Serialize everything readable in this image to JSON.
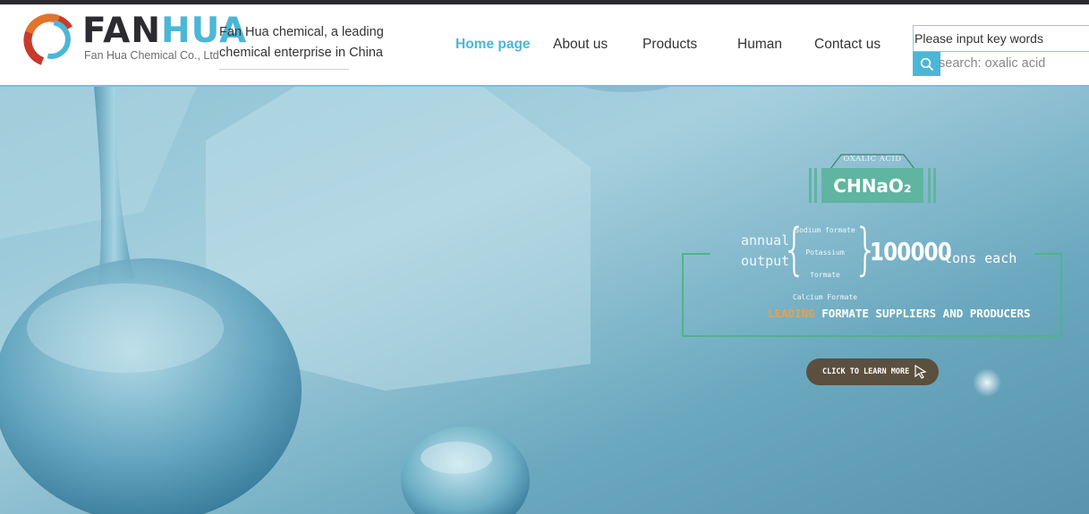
{
  "header": {
    "logo_text_part1": "FAN",
    "logo_text_part2": "HUA",
    "logo_subtitle": "Fan Hua Chemical Co., Ltd",
    "tagline_line1": "Fan Hua chemical, a leading",
    "tagline_line2": "chemical enterprise in China",
    "brand_colors": {
      "dark": "#2c2c30",
      "accent": "#4bb7d6",
      "orange": "#e2732a",
      "red": "#c73a2c"
    }
  },
  "nav": {
    "items": [
      {
        "label": "Home page",
        "active": true
      },
      {
        "label": "About us",
        "active": false
      },
      {
        "label": "Products",
        "active": false
      },
      {
        "label": "Human",
        "active": false
      },
      {
        "label": "Contact us",
        "active": false
      }
    ],
    "active_color": "#4bb7d6"
  },
  "search": {
    "placeholder": "Please input key words",
    "button_icon": "search-icon",
    "hot_search": "search: oxalic acid"
  },
  "banner": {
    "formula_label": "OXALIC ACID",
    "formula": "CHNaO₂",
    "annual_line1": "annual",
    "annual_line2": "output",
    "chemicals": [
      "Sodium formate",
      "Potassium formate",
      "Calcium Formate"
    ],
    "quantity": "100000",
    "unit": "tons each",
    "leading_highlight": "LEADING",
    "leading_rest": "FORMATE SUPPLIERS AND PRODUCERS",
    "cta_label": "CLICK TO LEARN MORE",
    "cta_icon": "cursor-icon",
    "colors": {
      "green": "#5fb5a0",
      "frame": "#4fb48a",
      "highlight": "#e8a04a",
      "cta_bg": "#5b4f3e"
    }
  }
}
